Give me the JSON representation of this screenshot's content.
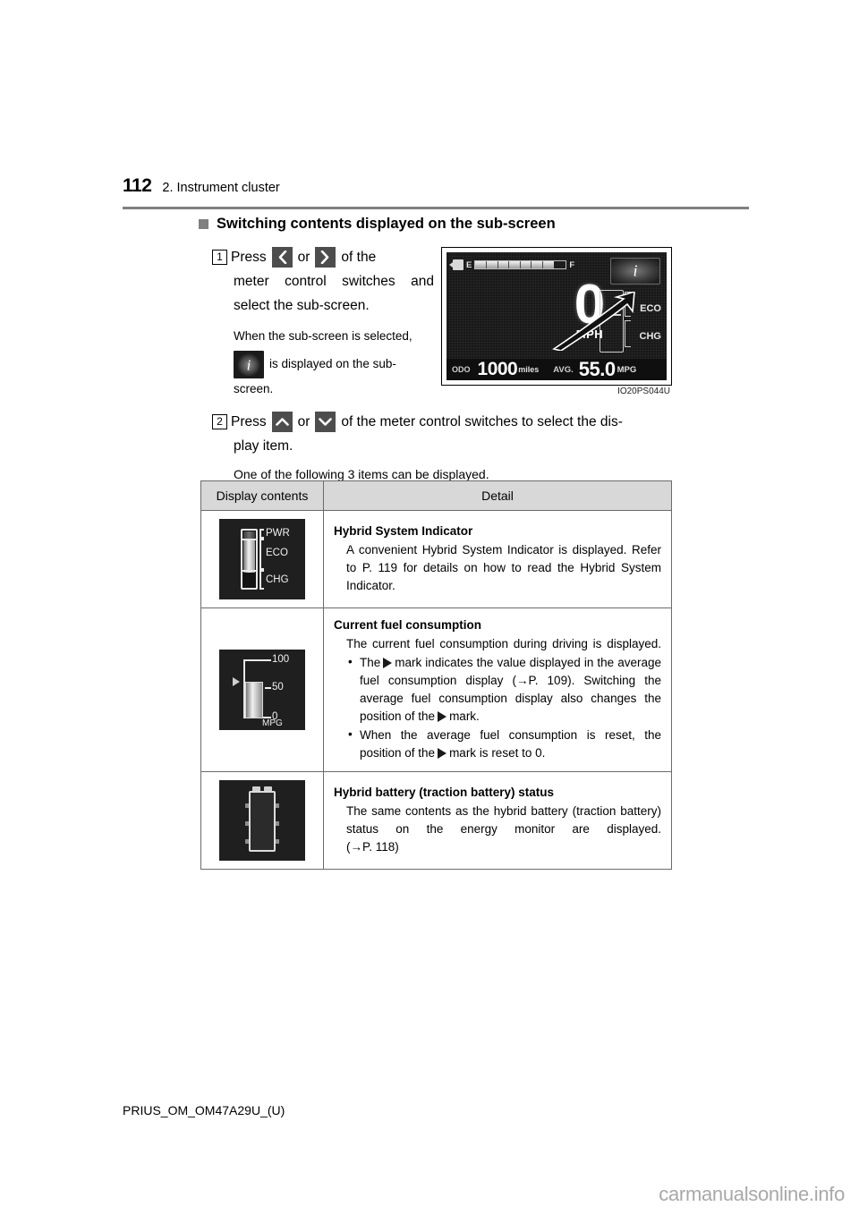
{
  "header": {
    "page_number": "112",
    "title": "2. Instrument cluster"
  },
  "section": {
    "heading": "Switching contents displayed on the sub-screen"
  },
  "step1": {
    "number": "1",
    "text_part1": "Press",
    "left_button_icon": "chevron-left-icon",
    "or_label": "or",
    "right_button_icon": "chevron-right-icon",
    "text_part2": "of  the",
    "line2": "meter control switches and",
    "line3": "select the sub-screen.",
    "note": "When the sub-screen is selected,",
    "info_icon": "info-i-icon",
    "note_tail": "is  displayed  on  the  sub-",
    "note_tail2": "screen."
  },
  "step2": {
    "number": "2",
    "text_part1": "Press",
    "up_button_icon": "chevron-up-icon",
    "or_label": "or",
    "down_button_icon": "chevron-down-icon",
    "text_part2": "of the meter control switches to select the dis-",
    "line2": "play item.",
    "note": "One of the following 3 items can be displayed."
  },
  "figure": {
    "caption": "IO20PS044U",
    "cluster": {
      "fuel_empty_label": "E",
      "fuel_full_label": "F",
      "fuel_pump_icon": "fuel-pump-icon",
      "speed_value": "0",
      "speed_unit": "MPH",
      "eco_label": "ECO",
      "chg_label": "CHG",
      "info_button_icon": "info-i-icon",
      "cursor_icon": "cursor-arrow-icon",
      "odo_label": "ODO",
      "odo_value": "1000",
      "odo_unit": "miles",
      "avg_label": "AVG.",
      "avg_value": "55.0",
      "avg_unit": "MPG"
    }
  },
  "table": {
    "headers": [
      "Display contents",
      "Detail"
    ],
    "rows": [
      {
        "icon_name": "hybrid-system-indicator-icon",
        "icon_labels": {
          "pwr": "PWR",
          "eco": "ECO",
          "chg": "CHG"
        },
        "title": "Hybrid System Indicator",
        "body": "A convenient Hybrid System Indicator is displayed. Refer to P. 119 for details on how to read the Hybrid System Indicator.",
        "bullets": []
      },
      {
        "icon_name": "current-fuel-consumption-icon",
        "icon_labels": {
          "top": "100",
          "mid": "50",
          "bottom": "0",
          "unit": "MPG"
        },
        "title": "Current fuel consumption",
        "body": "The current fuel consumption during driving is displayed.",
        "bullet1_a": "The",
        "bullet1_b": "mark indicates the value displayed in the average  fuel  consumption  display  (",
        "bullet1_ref": "P. 109).",
        "bullet1_c": "Switching the average fuel consumption display also changes the position of the",
        "bullet1_d": "mark.",
        "bullet2_a": "When the average fuel consumption is reset, the position of the",
        "bullet2_b": "mark is reset to 0."
      },
      {
        "icon_name": "hybrid-battery-status-icon",
        "icon_labels": {},
        "title": "Hybrid battery (traction battery) status",
        "body": "The  same  contents  as  the  hybrid  battery  (traction battery) status on the energy monitor are displayed.",
        "ref": "P. 118"
      }
    ]
  },
  "footer": {
    "document_code": "PRIUS_OM_OM47A29U_(U)",
    "watermark": "carmanualsonline.info"
  }
}
